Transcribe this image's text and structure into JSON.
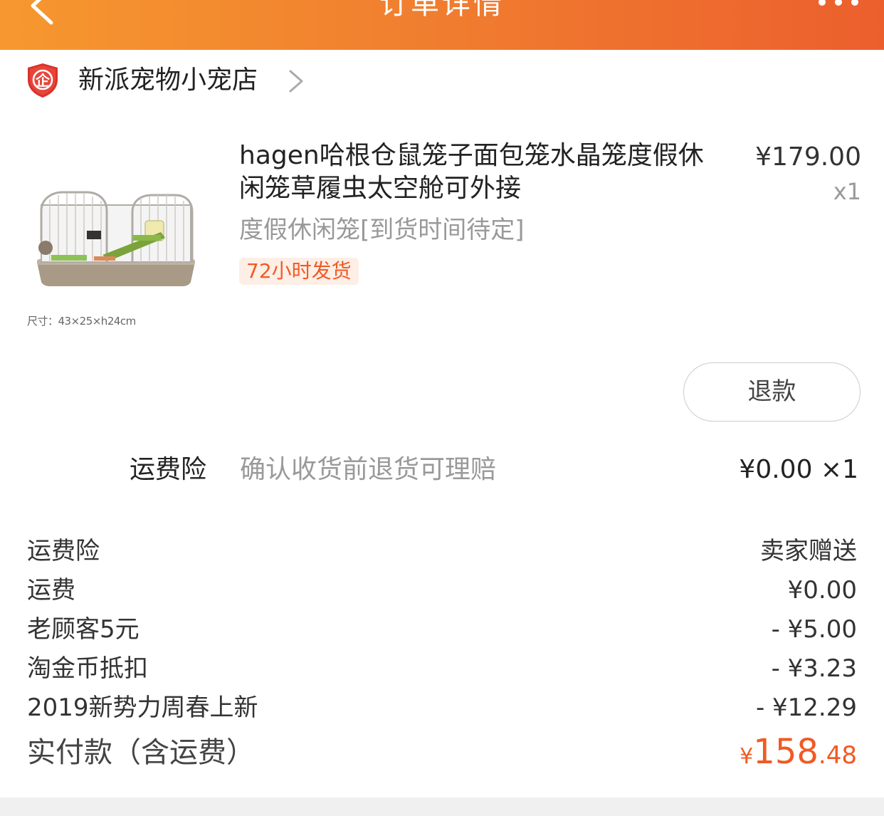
{
  "header": {
    "title": "订单详情",
    "back_icon": "chevron-left-icon",
    "more_icon": "more-dots-icon",
    "colors": {
      "start": "#f6982f",
      "end": "#ec5f2d"
    }
  },
  "shop": {
    "badge_char": "企",
    "name": "新派宠物小宠店"
  },
  "product": {
    "title": "hagen哈根仓鼠笼子面包笼水晶笼度假休闲笼草履虫太空舱可外接",
    "price": "¥179.00",
    "quantity": "x1",
    "sku": "度假休闲笼[到货时间待定]",
    "shipping_tag": "72小时发货",
    "image_caption": "尺寸：43×25×h24cm"
  },
  "actions": {
    "refund": "退款"
  },
  "insurance": {
    "label": "运费险",
    "description": "确认收货前退货可理赔",
    "price": "¥0.00 ×1"
  },
  "summary": [
    {
      "label": "运费险",
      "value": "卖家赠送"
    },
    {
      "label": "运费",
      "value": "¥0.00"
    },
    {
      "label": "老顾客5元",
      "value": "- ¥5.00"
    },
    {
      "label": "淘金币抵扣",
      "value": "- ¥3.23"
    },
    {
      "label": "2019新势力周春上新",
      "value": "- ¥12.29"
    }
  ],
  "total": {
    "label": "实付款（含运费）",
    "currency": "¥",
    "integer": "158",
    "decimal": ".48",
    "color": "#f05a24"
  }
}
